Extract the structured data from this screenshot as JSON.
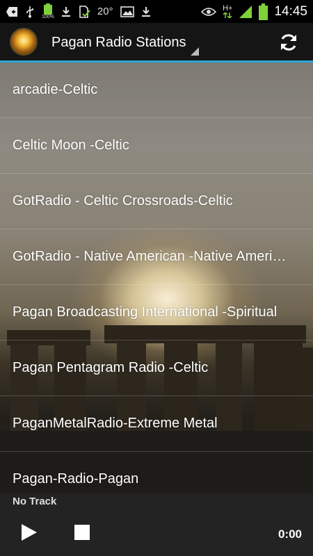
{
  "status_bar": {
    "battery_small_text": "100%",
    "temperature": "20°",
    "time": "14:45",
    "icons": [
      "add-icon",
      "usb-icon",
      "battery-small-icon",
      "download-icon",
      "sd-check-icon",
      "image-icon",
      "download-icon",
      "eye-icon",
      "hplus-icon",
      "signal-icon",
      "battery-icon"
    ],
    "hplus_text": "H+"
  },
  "action_bar": {
    "title": "Pagan Radio Stations",
    "refresh_icon": "refresh-icon",
    "accent_color": "#2aa8d8"
  },
  "stations": [
    {
      "label": "arcadie-Celtic"
    },
    {
      "label": "Celtic Moon -Celtic"
    },
    {
      "label": "GotRadio - Celtic Crossroads-Celtic"
    },
    {
      "label": "GotRadio - Native American -Native American"
    },
    {
      "label": "Pagan Broadcasting International -Spiritual"
    },
    {
      "label": "Pagan Pentagram Radio -Celtic"
    },
    {
      "label": "PaganMetalRadio-Extreme Metal"
    },
    {
      "label": "Pagan-Radio-Pagan"
    }
  ],
  "player": {
    "now_playing": "No Track",
    "time": "0:00",
    "play_icon": "play-icon",
    "stop_icon": "stop-icon"
  }
}
